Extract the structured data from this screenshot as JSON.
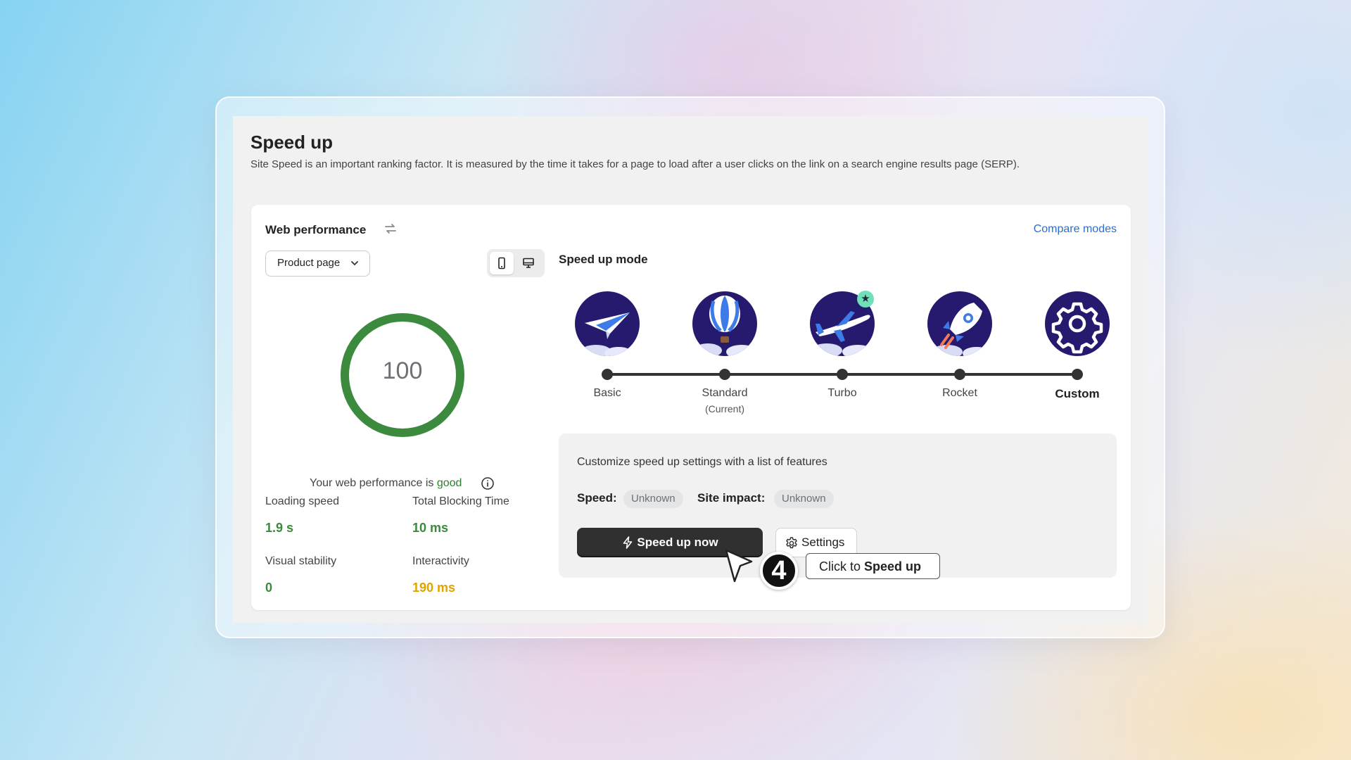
{
  "page": {
    "title": "Speed up",
    "description": "Site Speed is an important ranking factor. It is measured by the time it takes for a page to load after a user clicks on the link on a search engine results page (SERP)."
  },
  "web_performance": {
    "title": "Web performance",
    "compare_link": "Compare modes",
    "page_select": "Product page",
    "device_selected": "mobile",
    "score": "100",
    "status_prefix": "Your web performance is",
    "status_value": "good",
    "metrics": [
      {
        "label": "Loading speed",
        "value": "1.9 s",
        "color": "#3b8a3e"
      },
      {
        "label": "Total Blocking Time",
        "value": "10 ms",
        "color": "#3b8a3e"
      },
      {
        "label": "Visual stability",
        "value": "0",
        "color": "#3b8a3e"
      },
      {
        "label": "Interactivity",
        "value": "190 ms",
        "color": "#e2a300"
      }
    ]
  },
  "speed_up_mode": {
    "title": "Speed up mode",
    "modes": [
      {
        "label": "Basic",
        "sub": "",
        "icon": "paper-plane-icon"
      },
      {
        "label": "Standard",
        "sub": "(Current)",
        "icon": "hot-air-balloon-icon"
      },
      {
        "label": "Turbo",
        "sub": "",
        "icon": "airplane-icon"
      },
      {
        "label": "Rocket",
        "sub": "",
        "icon": "rocket-icon"
      },
      {
        "label": "Custom",
        "sub": "",
        "icon": "gear-icon",
        "selected": true
      }
    ],
    "recommended_star": "★"
  },
  "custom_settings": {
    "description": "Customize speed up settings with a list of features",
    "speed_label": "Speed:",
    "speed_value": "Unknown",
    "impact_label": "Site impact:",
    "impact_value": "Unknown",
    "primary_button": "Speed up now",
    "secondary_button": "Settings"
  },
  "tutorial": {
    "step": "4",
    "tooltip_prefix": "Click to",
    "tooltip_bold": "Speed up"
  },
  "colors": {
    "accent_link": "#2c6ecb",
    "score_ring": "#3b8a3e",
    "mode_icon_bg": "#261a6e",
    "primary_button": "#303030"
  }
}
